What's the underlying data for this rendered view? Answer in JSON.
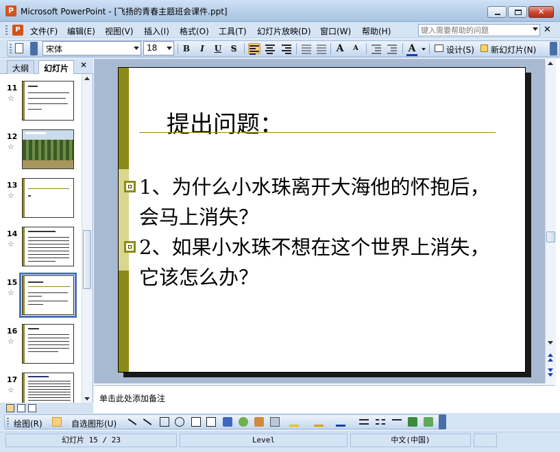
{
  "window": {
    "title": "Microsoft PowerPoint - [飞扬的青春主题班会课件.ppt]",
    "logo_letter": "P",
    "close_glyph": "✕"
  },
  "menu": {
    "items": [
      "文件(F)",
      "编辑(E)",
      "视图(V)",
      "插入(I)",
      "格式(O)",
      "工具(T)",
      "幻灯片放映(D)",
      "窗口(W)",
      "帮助(H)"
    ],
    "help_placeholder": "键入需要帮助的问题",
    "close_glyph": "✕"
  },
  "toolbar": {
    "font_name": "宋体",
    "font_size": "18",
    "bold": "B",
    "italic": "I",
    "underline": "U",
    "shadow": "S",
    "grow_font": "A",
    "shrink_font": "A",
    "font_color": "A",
    "design_label": "设计(S)",
    "new_slide_label": "新幻灯片(N)"
  },
  "left_pane": {
    "tabs": [
      "大纲",
      "幻灯片"
    ],
    "active_tab": "幻灯片",
    "close_glyph": "✕",
    "thumbnails": [
      {
        "number": "11",
        "selected": false
      },
      {
        "number": "12",
        "selected": false
      },
      {
        "number": "13",
        "selected": false
      },
      {
        "number": "14",
        "selected": false
      },
      {
        "number": "15",
        "selected": true
      },
      {
        "number": "16",
        "selected": false
      },
      {
        "number": "17",
        "selected": false
      }
    ]
  },
  "slide": {
    "title": "提出问题：",
    "bullets": [
      "1、为什么小水珠离开大海他的怀抱后，会马上消失？",
      "2、如果小水珠不想在这个世界上消失，它该怎么办？"
    ],
    "accent_color": "#8c8a16"
  },
  "notes": {
    "placeholder": "单击此处添加备注"
  },
  "draw_toolbar": {
    "draw_label": "绘图(R)",
    "autoshapes_label": "自选图形(U)"
  },
  "status": {
    "slide_position": "幻灯片 15 / 23",
    "design": "Level",
    "language": "中文(中国)"
  }
}
